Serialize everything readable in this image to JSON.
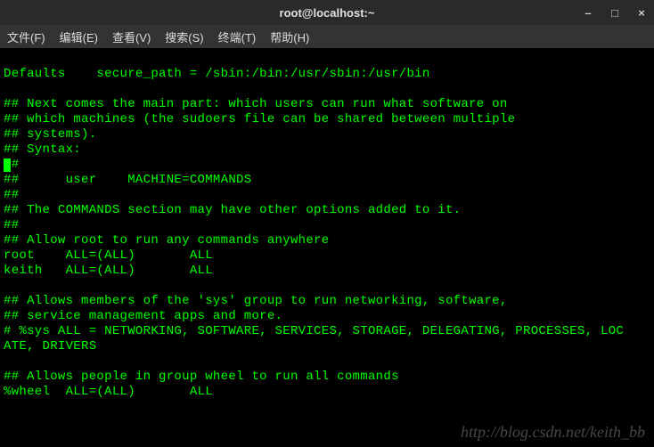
{
  "titlebar": {
    "title": "root@localhost:~"
  },
  "window_controls": {
    "minimize": "–",
    "maximize": "□",
    "close": "×"
  },
  "menubar": {
    "file": "文件(F)",
    "edit": "编辑(E)",
    "view": "查看(V)",
    "search": "搜索(S)",
    "terminal": "终端(T)",
    "help": "帮助(H)"
  },
  "terminal": {
    "lines": [
      "Defaults    secure_path = /sbin:/bin:/usr/sbin:/usr/bin",
      "",
      "## Next comes the main part: which users can run what software on",
      "## which machines (the sudoers file can be shared between multiple",
      "## systems).",
      "## Syntax:",
      "##",
      "##      user    MACHINE=COMMANDS",
      "##",
      "## The COMMANDS section may have other options added to it.",
      "##",
      "## Allow root to run any commands anywhere",
      "root    ALL=(ALL)       ALL",
      "keith   ALL=(ALL)       ALL",
      "",
      "## Allows members of the 'sys' group to run networking, software,",
      "## service management apps and more.",
      "# %sys ALL = NETWORKING, SOFTWARE, SERVICES, STORAGE, DELEGATING, PROCESSES, LOC",
      "ATE, DRIVERS",
      "",
      "## Allows people in group wheel to run all commands",
      "%wheel  ALL=(ALL)       ALL"
    ]
  },
  "watermark": "http://blog.csdn.net/keith_bb"
}
